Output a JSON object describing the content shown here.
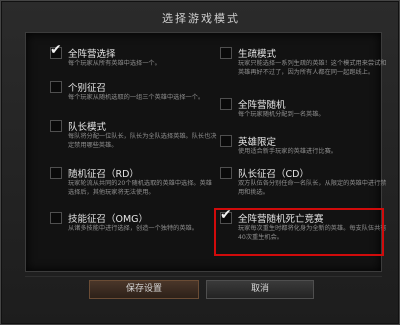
{
  "dialog": {
    "title": "选择游戏模式"
  },
  "options": {
    "all_pick": {
      "title": "全阵营选择",
      "desc": "每个玩家从所有英雄中选择一个。",
      "checked": true
    },
    "single_draft": {
      "title": "个别征召",
      "desc": "每个玩家从随机选取的一组三个英雄中选择一个。",
      "checked": false
    },
    "captains_mode": {
      "title": "队长模式",
      "desc": "每队将分配一位队长，队长为全队选择英雄。队长也决定禁用哪些英雄。",
      "checked": false
    },
    "random_draft": {
      "title": "随机征召（RD）",
      "desc": "玩家轮流从共同的20个随机选取的英雄中选择。英雄选择后，其他玩家将无法使用。",
      "checked": false
    },
    "ability_draft": {
      "title": "技能征召（OMG）",
      "desc": "从诸多技能中进行选择，创造一个独特的英雄。",
      "checked": false
    },
    "least_played": {
      "title": "生疏模式",
      "desc": "玩家只能选择一系列生疏的英雄！这个模式用来尝试和英雄再好不过了，因为所有人都在同一起跑线上。",
      "checked": false
    },
    "all_random": {
      "title": "全阵营随机",
      "desc": "每个玩家随机分配到一名英雄。",
      "checked": false
    },
    "hero_limit": {
      "title": "英雄限定",
      "desc": "使用适合新手玩家的英雄进行比赛。",
      "checked": false
    },
    "captains_draft": {
      "title": "队长征召（CD）",
      "desc": "双方队伍各分别任命一名队长，从限定的英雄中进行禁用和挑选。",
      "checked": false
    },
    "all_random_deathmatch": {
      "title": "全阵营随机死亡竞赛",
      "desc": "玩家每次重生时都将化身为全新的英雄。每支队伍共有40次重生机会。",
      "checked": true
    }
  },
  "buttons": {
    "save": "保存设置",
    "cancel": "取消"
  },
  "icons": {
    "check": "✔"
  },
  "colors": {
    "highlight": "#d10b0b"
  }
}
